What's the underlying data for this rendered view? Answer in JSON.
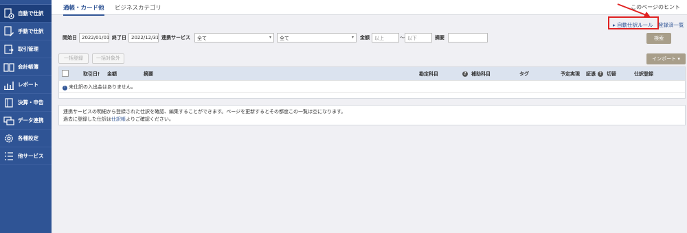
{
  "sidebar": {
    "items": [
      {
        "label": "自動で仕訳",
        "icon": "auto-journal-icon",
        "active": true
      },
      {
        "label": "手動で仕訳",
        "icon": "manual-journal-icon",
        "active": false
      },
      {
        "label": "取引管理",
        "icon": "transaction-icon",
        "active": false
      },
      {
        "label": "会計帳簿",
        "icon": "ledger-icon",
        "active": false
      },
      {
        "label": "レポート",
        "icon": "report-icon",
        "active": false
      },
      {
        "label": "決算・申告",
        "icon": "tax-return-icon",
        "active": false
      },
      {
        "label": "データ連携",
        "icon": "data-link-icon",
        "active": false
      },
      {
        "label": "各種設定",
        "icon": "gear-icon",
        "active": false
      },
      {
        "label": "他サービス",
        "icon": "other-services-icon",
        "active": false
      }
    ]
  },
  "tabs": {
    "tab1": "通帳・カード他",
    "tab2": "ビジネスカテゴリ"
  },
  "hint": "このページのヒント",
  "links": {
    "auto_rules": "自動仕訳ルール",
    "registered": "登録済一覧"
  },
  "filter": {
    "start_label": "開始日",
    "start_value": "2022/01/01",
    "end_label": "終了日",
    "end_value": "2022/12/31",
    "service_label": "連携サービス",
    "service_value": "全て",
    "service2_value": "全て",
    "amount_label": "金額",
    "amount_min_placeholder": "以上",
    "tilde": "〜",
    "amount_max_placeholder": "以下",
    "memo_label": "摘要",
    "memo_value": ""
  },
  "buttons": {
    "search": "検索",
    "bulk_register": "一括登録",
    "bulk_exclude": "一括対象外",
    "import": "インポート ▾"
  },
  "table": {
    "headers": {
      "date": "取引日",
      "amount": "金額",
      "memo": "摘要",
      "account": "勘定科目",
      "sub_account": "補助科目",
      "tag": "タグ",
      "planned": "予定実現",
      "evidence": "証憑",
      "split": "切替",
      "register": "仕訳登録"
    },
    "empty_message": "未仕訳の入出金はありません。"
  },
  "note": {
    "line1": "連携サービスの明細から登録された仕訳を確認、編集することができます。ページを更新するとその都度この一覧は空になります。",
    "line2_prefix": "過去に登録した仕訳は",
    "line2_link": "仕訳帳",
    "line2_suffix": "よりご確認ください。"
  },
  "colors": {
    "sidebar": "#2f5495",
    "accent": "#2f5495",
    "highlight": "#e02020"
  }
}
